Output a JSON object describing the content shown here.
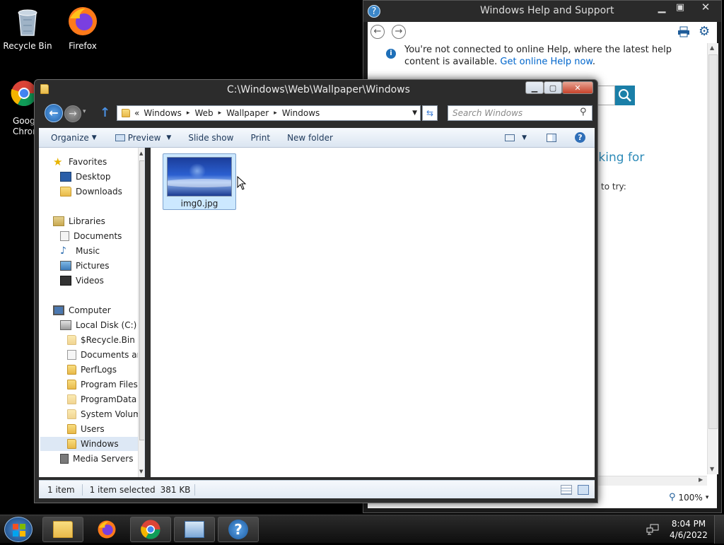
{
  "desktop": {
    "icons": [
      {
        "label": "Recycle Bin",
        "icon": "recycle-bin-icon"
      },
      {
        "label": "Firefox",
        "icon": "firefox-icon"
      },
      {
        "label": "Goog Chron",
        "icon": "chrome-icon"
      }
    ]
  },
  "help": {
    "title": "Windows Help and Support",
    "notice": "You're not connected to online Help, where the latest help content is available.",
    "notice_link": "Get online Help now",
    "partial_heading": "oking for",
    "partial_text": "to try:",
    "zoom": "100%"
  },
  "explorer": {
    "title": "C:\\Windows\\Web\\Wallpaper\\Windows",
    "breadcrumb": [
      "«",
      "Windows",
      "Web",
      "Wallpaper",
      "Windows"
    ],
    "search_placeholder": "Search Windows",
    "toolbar": {
      "organize": "Organize",
      "preview": "Preview",
      "slideshow": "Slide show",
      "print": "Print",
      "new_folder": "New folder"
    },
    "nav": {
      "favorites": "Favorites",
      "desktop": "Desktop",
      "downloads": "Downloads",
      "libraries": "Libraries",
      "documents": "Documents",
      "music": "Music",
      "pictures": "Pictures",
      "videos": "Videos",
      "computer": "Computer",
      "local_disk": "Local Disk (C:)",
      "recycle": "$Recycle.Bin",
      "docs_and": "Documents and",
      "perflogs": "PerfLogs",
      "program_files": "Program Files",
      "program_data": "ProgramData",
      "system_volume": "System Volume",
      "users": "Users",
      "windows": "Windows",
      "media_servers": "Media Servers"
    },
    "files": [
      {
        "name": "img0.jpg",
        "selected": true
      }
    ],
    "status": {
      "count": "1 item",
      "selected": "1 item selected",
      "size": "381 KB"
    }
  },
  "taskbar": {
    "time": "8:04 PM",
    "date": "4/6/2022",
    "buttons": [
      "explorer-icon",
      "firefox-icon",
      "chrome-icon",
      "control-panel-icon",
      "help-icon"
    ]
  },
  "colors": {
    "accent": "#1e5c99",
    "selection": "#cce8ff",
    "link": "#0066cc"
  }
}
